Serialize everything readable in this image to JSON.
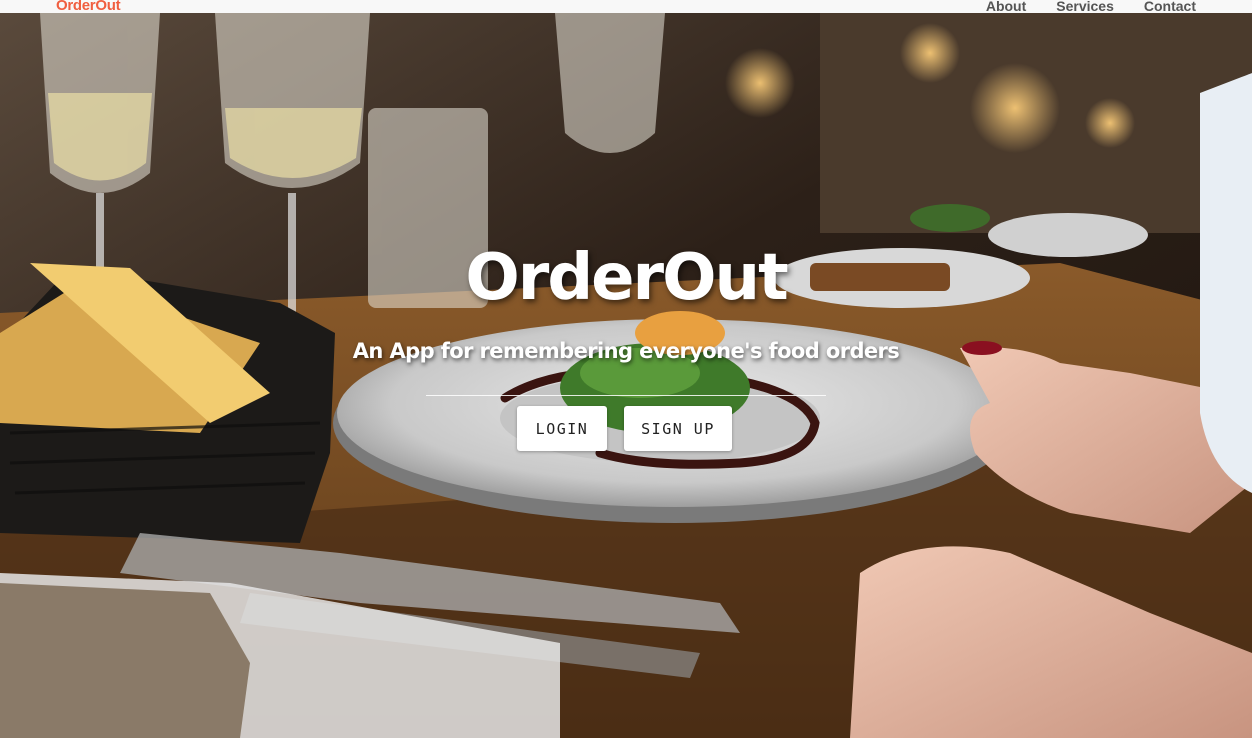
{
  "navbar": {
    "brand": "OrderOut",
    "links": [
      "About",
      "Services",
      "Contact"
    ]
  },
  "hero": {
    "title": "OrderOut",
    "subtitle": "An App for remembering everyone's food orders",
    "buttons": {
      "login": "LOGIN",
      "signup": "SIGN UP"
    },
    "background_image": "restaurant table with plated salad, bread basket, wine glasses"
  },
  "colors": {
    "brand": "#f05f40",
    "nav_bg": "#f8f8f8",
    "nav_text": "#555555",
    "button_bg": "#ffffff",
    "button_text": "#222222"
  }
}
